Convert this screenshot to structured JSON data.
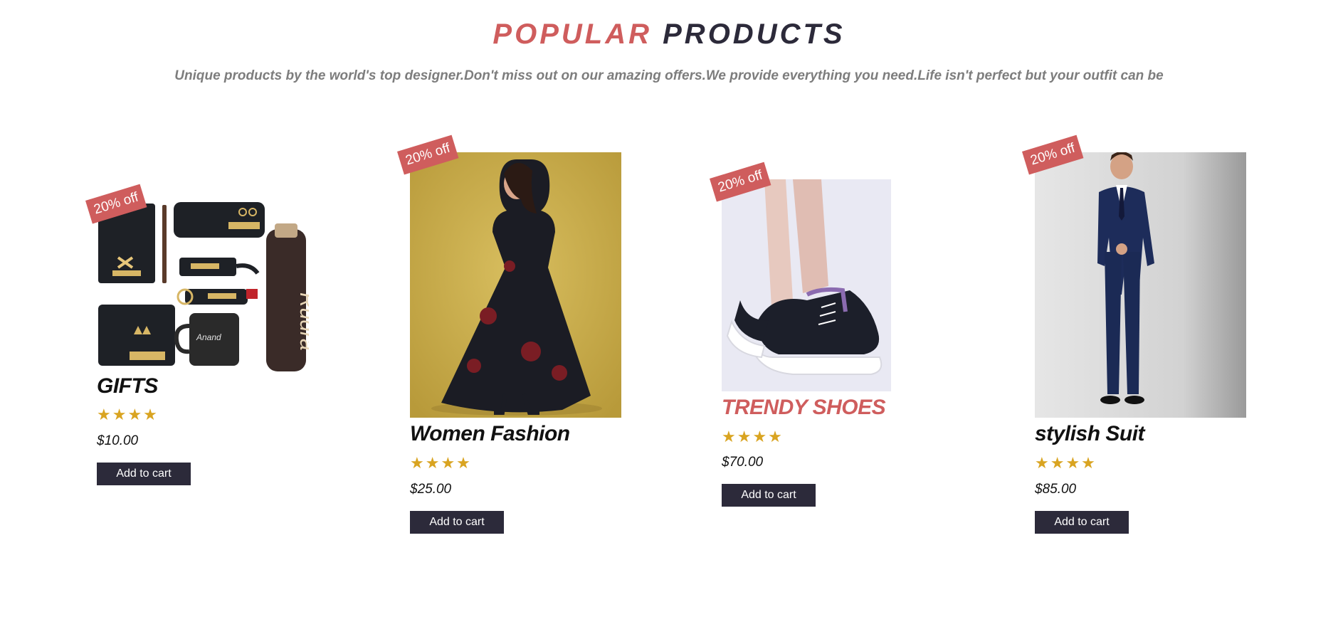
{
  "section": {
    "title_part1": "POPULAR",
    "title_part2": "PRODUCTS",
    "subtitle": "Unique products by the world's top designer.Don't miss out on our amazing offers.We provide everything you need.Life isn't perfect but your outfit can be"
  },
  "colors": {
    "accent": "#cf5d5d",
    "dark": "#2c2a3a",
    "star": "#d9a421"
  },
  "products": [
    {
      "name": "GIFTS",
      "stars": "★★★★",
      "rating": 4,
      "price": "$10.00",
      "badge": "20% off",
      "button": "Add to cart",
      "name_color": "#111111"
    },
    {
      "name": "Women Fashion",
      "stars": "★★★★",
      "rating": 4,
      "price": "$25.00",
      "badge": "20% off",
      "button": "Add to cart",
      "name_color": "#111111"
    },
    {
      "name": "TRENDY SHOES",
      "stars": "★★★★",
      "rating": 4,
      "price": "$70.00",
      "badge": "20% off",
      "button": "Add to cart",
      "name_color": "#cf5d5d"
    },
    {
      "name": "stylish Suit",
      "stars": "★★★★",
      "rating": 4,
      "price": "$85.00",
      "badge": "20% off",
      "button": "Add to cart",
      "name_color": "#111111"
    }
  ]
}
